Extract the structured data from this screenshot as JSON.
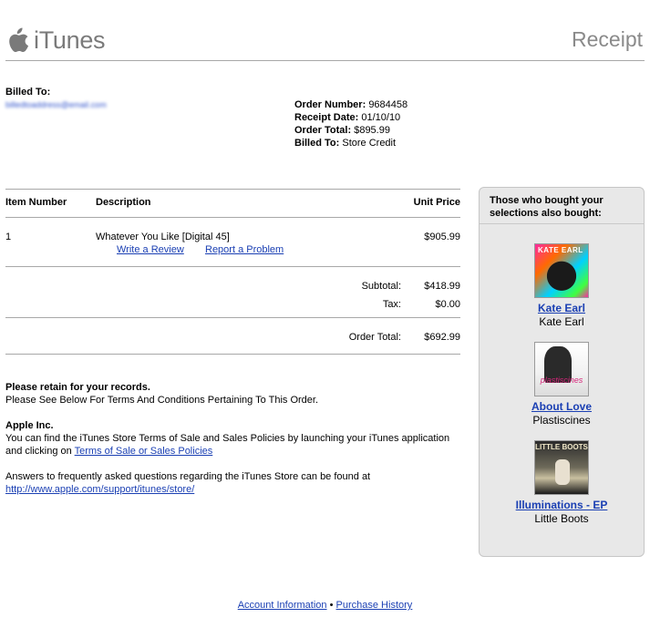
{
  "header": {
    "logo_text": "iTunes",
    "title": "Receipt"
  },
  "billing": {
    "billed_to_label": "Billed To:",
    "email": "billedtoaddress@email.com"
  },
  "order": {
    "number_label": "Order Number:",
    "number": "9684458",
    "date_label": "Receipt Date:",
    "date": "01/10/10",
    "total_label": "Order Total:",
    "total": "$895.99",
    "billed_label": "Billed To:",
    "billed": "Store Credit"
  },
  "table": {
    "headers": {
      "item": "Item Number",
      "description": "Description",
      "price": "Unit Price"
    },
    "rows": [
      {
        "item": "1",
        "description": "Whatever You Like [Digital 45]",
        "price": "$905.99",
        "write_review": "Write a Review",
        "report_problem": "Report a Problem"
      }
    ],
    "subtotal_label": "Subtotal:",
    "subtotal": "$418.99",
    "tax_label": "Tax:",
    "tax": "$0.00",
    "order_total_label": "Order Total:",
    "order_total": "$692.99"
  },
  "notes": {
    "retain_title": "Please retain for your records.",
    "retain_text": "Please See Below For Terms And Conditions Pertaining To This Order.",
    "company": "Apple Inc.",
    "terms_line1": "You can find the iTunes Store Terms of Sale and Sales Policies by launching your iTunes application",
    "terms_line2": "and clicking on",
    "terms_link": "Terms of Sale or Sales Policies",
    "faq_text": "Answers to frequently asked questions regarding the iTunes Store can be found at",
    "faq_link": "http://www.apple.com/support/itunes/store/"
  },
  "sidebar": {
    "heading": "Those who bought your selections also bought:",
    "items": [
      {
        "title": "Kate Earl",
        "artist": "Kate Earl",
        "art_text": "KATE EARL"
      },
      {
        "title": "About Love",
        "artist": "Plastiscines",
        "art_text": "plastiscines"
      },
      {
        "title": "Illuminations - EP",
        "artist": "Little Boots",
        "art_text": "LITTLE BOOTS"
      }
    ]
  },
  "footer": {
    "account": "Account Information",
    "separator": "•",
    "history": "Purchase History"
  },
  "colors": {
    "link": "#1a3fb3",
    "rule": "#a8a8a8",
    "sidebar_bg": "#e8e8e8",
    "logo_gray": "#7a7a7a"
  }
}
